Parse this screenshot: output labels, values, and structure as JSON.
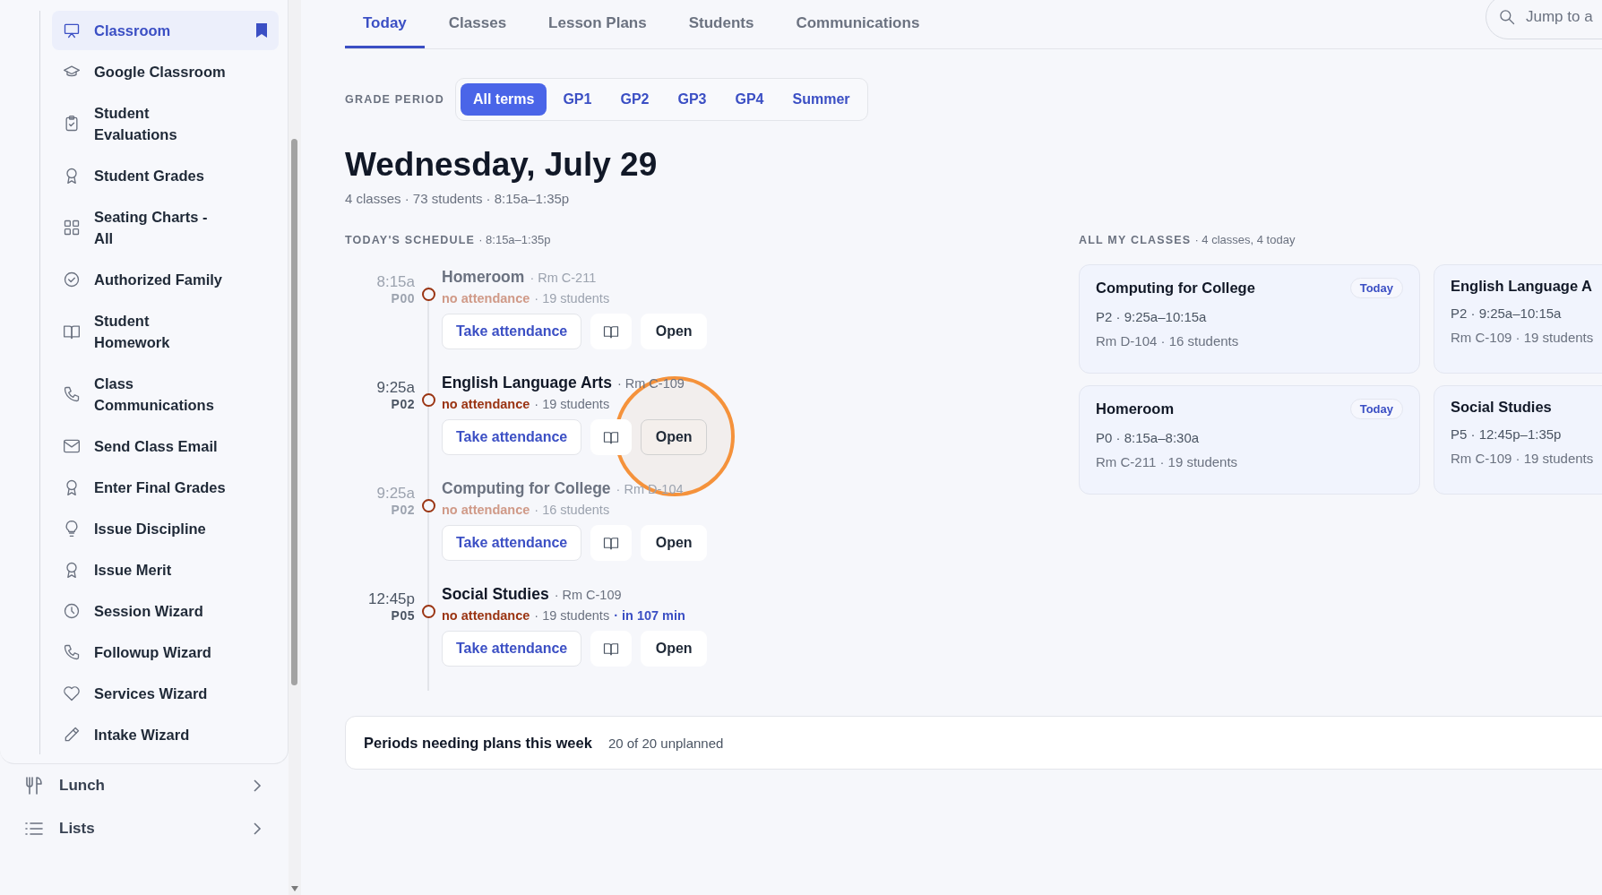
{
  "sidebar": {
    "items": [
      {
        "label": "Classroom",
        "selected": true,
        "bookmarked": true
      },
      {
        "label": "Google Classroom",
        "selected": false,
        "bookmarked": false
      },
      {
        "label": "Student\nEvaluations",
        "selected": false,
        "bookmarked": false
      },
      {
        "label": "Student Grades",
        "selected": false,
        "bookmarked": false
      },
      {
        "label": "Seating Charts -\nAll",
        "selected": false,
        "bookmarked": false
      },
      {
        "label": "Authorized Family",
        "selected": false,
        "bookmarked": false
      },
      {
        "label": "Student\nHomework",
        "selected": false,
        "bookmarked": false
      },
      {
        "label": "Class\nCommunications",
        "selected": false,
        "bookmarked": false
      },
      {
        "label": "Send Class Email",
        "selected": false,
        "bookmarked": false
      },
      {
        "label": "Enter Final Grades",
        "selected": false,
        "bookmarked": false
      },
      {
        "label": "Issue Discipline",
        "selected": false,
        "bookmarked": false
      },
      {
        "label": "Issue Merit",
        "selected": false,
        "bookmarked": false
      },
      {
        "label": "Session Wizard",
        "selected": false,
        "bookmarked": false
      },
      {
        "label": "Followup Wizard",
        "selected": false,
        "bookmarked": false
      },
      {
        "label": "Services Wizard",
        "selected": false,
        "bookmarked": false
      },
      {
        "label": "Intake Wizard",
        "selected": false,
        "bookmarked": false
      }
    ],
    "sections": [
      {
        "label": "Lunch"
      },
      {
        "label": "Lists"
      }
    ]
  },
  "tabs": [
    {
      "label": "Today",
      "selected": true
    },
    {
      "label": "Classes",
      "selected": false
    },
    {
      "label": "Lesson Plans",
      "selected": false
    },
    {
      "label": "Students",
      "selected": false
    },
    {
      "label": "Communications",
      "selected": false
    }
  ],
  "search": {
    "placeholder": "Jump to a"
  },
  "grade_period": {
    "label": "GRADE PERIOD",
    "options": [
      {
        "label": "All terms",
        "selected": true
      },
      {
        "label": "GP1",
        "selected": false
      },
      {
        "label": "GP2",
        "selected": false
      },
      {
        "label": "GP3",
        "selected": false
      },
      {
        "label": "GP4",
        "selected": false
      },
      {
        "label": "Summer",
        "selected": false
      }
    ]
  },
  "title": "Wednesday, July 29",
  "subtitle": "4 classes · 73 students · 8:15a–1:35p",
  "schedule": {
    "heading": "TODAY'S SCHEDULE",
    "range": "· 8:15a–1:35p",
    "entries": [
      {
        "time": "8:15a",
        "period": "P00",
        "name": "Homeroom",
        "room": "· Rm C-211",
        "attendance": "no attendance",
        "students": "· 19 students",
        "dimmed": true,
        "highlighted": false,
        "take_attendance": "Take attendance",
        "open": "Open"
      },
      {
        "time": "9:25a",
        "period": "P02",
        "name": "English Language Arts",
        "room": "· Rm C-109",
        "attendance": "no attendance",
        "students": "· 19 students",
        "dimmed": false,
        "highlighted": true,
        "take_attendance": "Take attendance",
        "open": "Open"
      },
      {
        "time": "9:25a",
        "period": "P02",
        "name": "Computing for College",
        "room": "· Rm D-104",
        "attendance": "no attendance",
        "students": "· 16 students",
        "dimmed": true,
        "highlighted": false,
        "take_attendance": "Take attendance",
        "open": "Open"
      },
      {
        "time": "12:45p",
        "period": "P05",
        "name": "Social Studies",
        "room": "· Rm C-109",
        "attendance": "no attendance",
        "students": "· 19 students",
        "countdown": "· in 107 min",
        "dimmed": false,
        "highlighted": false,
        "take_attendance": "Take attendance",
        "open": "Open"
      }
    ]
  },
  "classes": {
    "heading": "ALL MY CLASSES",
    "summary": "· 4 classes, 4 today",
    "cards": [
      {
        "title": "Computing for College",
        "badge": "Today",
        "schedule": "P2 · 9:25a–10:15a",
        "details": "Rm D-104 · 16 students"
      },
      {
        "title": "English Language A",
        "schedule": "P2 · 9:25a–10:15a",
        "details": "Rm C-109 · 19 students"
      },
      {
        "title": "Homeroom",
        "badge": "Today",
        "schedule": "P0 · 8:15a–8:30a",
        "details": "Rm C-211 · 19 students"
      },
      {
        "title": "Social Studies",
        "schedule": "P5 · 12:45p–1:35p",
        "details": "Rm C-109 · 19 students"
      }
    ]
  },
  "plans": {
    "title": "Periods needing plans this week",
    "summary": "20 of 20 unplanned"
  }
}
